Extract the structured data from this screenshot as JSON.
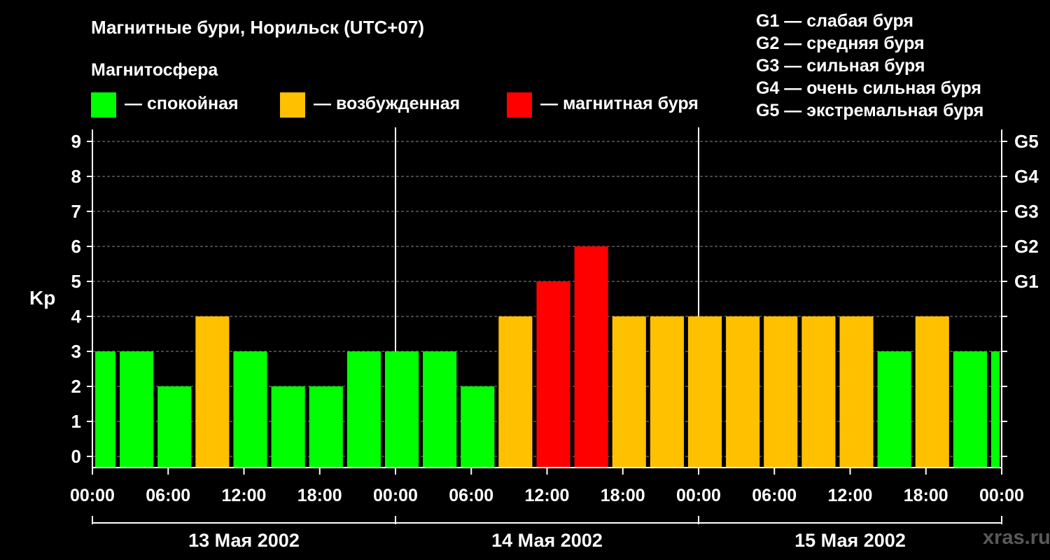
{
  "title": "Магнитные бури, Норильск (UTC+07)",
  "legend": {
    "heading": "Магнитосфера",
    "items": [
      {
        "label": "— спокойная",
        "color": "#00ff00"
      },
      {
        "label": "— возбужденная",
        "color": "#ffc000"
      },
      {
        "label": "— магнитная буря",
        "color": "#ff0000"
      }
    ]
  },
  "storm_levels": [
    "G1 — слабая буря",
    "G2 — средняя буря",
    "G3 — сильная буря",
    "G4 — очень сильная буря",
    "G5 — экстремальная буря"
  ],
  "watermark": "xras.ru",
  "chart_data": {
    "type": "bar",
    "ylabel": "Kp",
    "ylim": [
      0,
      9
    ],
    "yticks": [
      "0",
      "1",
      "2",
      "3",
      "4",
      "5",
      "6",
      "7",
      "8",
      "9"
    ],
    "right_ticks": [
      {
        "value": 5,
        "label": "G1"
      },
      {
        "value": 6,
        "label": "G2"
      },
      {
        "value": 7,
        "label": "G3"
      },
      {
        "value": 8,
        "label": "G4"
      },
      {
        "value": 9,
        "label": "G5"
      }
    ],
    "xticks": [
      "00:00",
      "06:00",
      "12:00",
      "18:00",
      "00:00",
      "06:00",
      "12:00",
      "18:00",
      "00:00",
      "06:00",
      "12:00",
      "18:00",
      "00:00"
    ],
    "days": [
      "13 Мая 2002",
      "14 Мая 2002",
      "15 Мая 2002"
    ],
    "time_offset_hours": -1,
    "interval_hours": 3,
    "x_range_hours": [
      0,
      72
    ],
    "grid": "dashed",
    "colors": {
      "quiet": "#00ff00",
      "active": "#ffc000",
      "storm": "#ff0000"
    },
    "values": [
      3,
      3,
      2,
      4,
      3,
      2,
      2,
      3,
      3,
      3,
      2,
      4,
      5,
      6,
      4,
      4,
      4,
      4,
      4,
      4,
      4,
      3,
      4,
      3,
      3
    ]
  }
}
